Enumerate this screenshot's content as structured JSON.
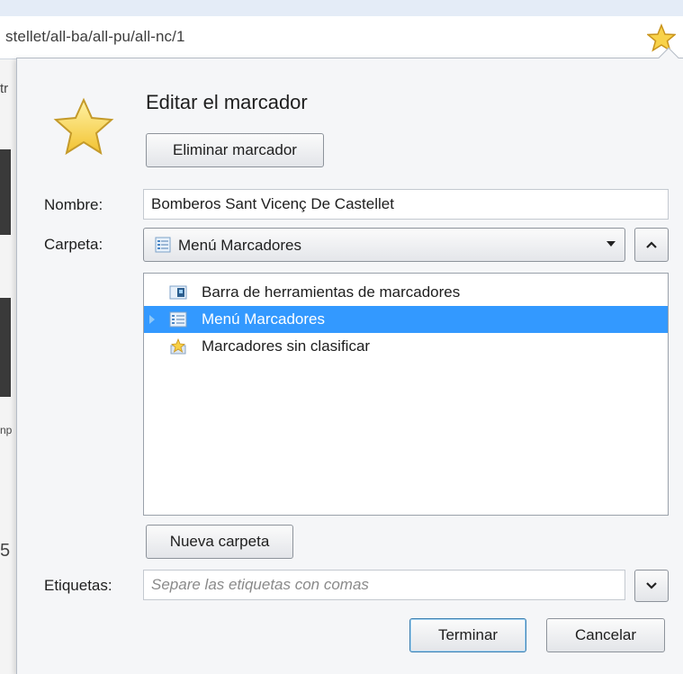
{
  "browser": {
    "url_text": "stellet/all-ba/all-pu/all-nc/1",
    "bg_fragments": [
      "tr",
      "np",
      "5"
    ]
  },
  "dialog": {
    "title": "Editar el marcador",
    "remove_button": "Eliminar marcador",
    "name_label": "Nombre:",
    "name_value": "Bomberos Sant Vicenç De Castellet",
    "folder_label": "Carpeta:",
    "folder_selected": "Menú Marcadores",
    "folder_tree": [
      {
        "label": "Barra de herramientas de marcadores",
        "icon": "toolbar-folder-icon",
        "selected": false
      },
      {
        "label": "Menú Marcadores",
        "icon": "menu-folder-icon",
        "selected": true
      },
      {
        "label": "Marcadores sin clasificar",
        "icon": "unsorted-bookmarks-icon",
        "selected": false
      }
    ],
    "new_folder_button": "Nueva carpeta",
    "tags_label": "Etiquetas:",
    "tags_placeholder": "Separe las etiquetas con comas",
    "done_button": "Terminar",
    "cancel_button": "Cancelar"
  },
  "colors": {
    "selection": "#3399ff",
    "star": "#f7d046",
    "dialog_bg": "#f5f6f8"
  }
}
